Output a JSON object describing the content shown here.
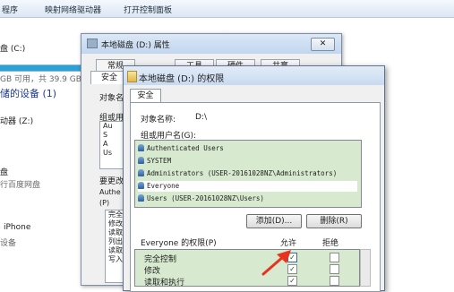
{
  "explorer": {
    "toolbar": [
      "程序",
      "映射网络驱动器",
      "打开控制面板"
    ],
    "drive_c_label": "盘 (C:)",
    "drive_c_space": "GB 可用，共 39.9 GB",
    "section_title": "储的设备 (1)",
    "drive_z_label": "动器 (Z:)",
    "baidu_label": "盘",
    "baidu_sub": "行百度网盘",
    "iphone_label": "iPhone",
    "iphone_sub": "设备"
  },
  "properties_dialog": {
    "title": "本地磁盘 (D:) 属性",
    "close_label": "✕",
    "tabs": [
      "常规",
      "工具",
      "硬件",
      "共享"
    ],
    "front_tab": "安全",
    "object_prefix": "对象名",
    "group_prefix": "组或用",
    "list_items": [
      "Au",
      "S",
      "A",
      "Us"
    ],
    "change_prefix": "要更改",
    "auth_prefix": "Authe",
    "perm_prefix": "(P)",
    "perm_items": [
      "完全",
      "修改",
      "读取",
      "列出",
      "读取",
      "写入"
    ]
  },
  "permissions_dialog": {
    "title": "本地磁盘 (D:) 的权限",
    "tab": "安全",
    "object_label": "对象名称:",
    "object_value": "D:\\",
    "groups_label": "组或用户名(G):",
    "groups": [
      "Authenticated Users",
      "SYSTEM",
      "Administrators (USER-20161028NZ\\Administrators)",
      "Everyone",
      "Users (USER-20161028NZ\\Users)"
    ],
    "add_button": "添加(D)...",
    "remove_button": "删除(R)",
    "permissions_for": "Everyone 的权限(P)",
    "allow_header": "允许",
    "deny_header": "拒绝",
    "permissions": [
      {
        "name": "完全控制",
        "allow": true,
        "deny": false
      },
      {
        "name": "修改",
        "allow": true,
        "deny": false
      },
      {
        "name": "读取和执行",
        "allow": true,
        "deny": false
      }
    ],
    "check_mark": "✓"
  },
  "colors": {
    "list_bg": "#d7eacf",
    "arrow": "#e8321e"
  }
}
